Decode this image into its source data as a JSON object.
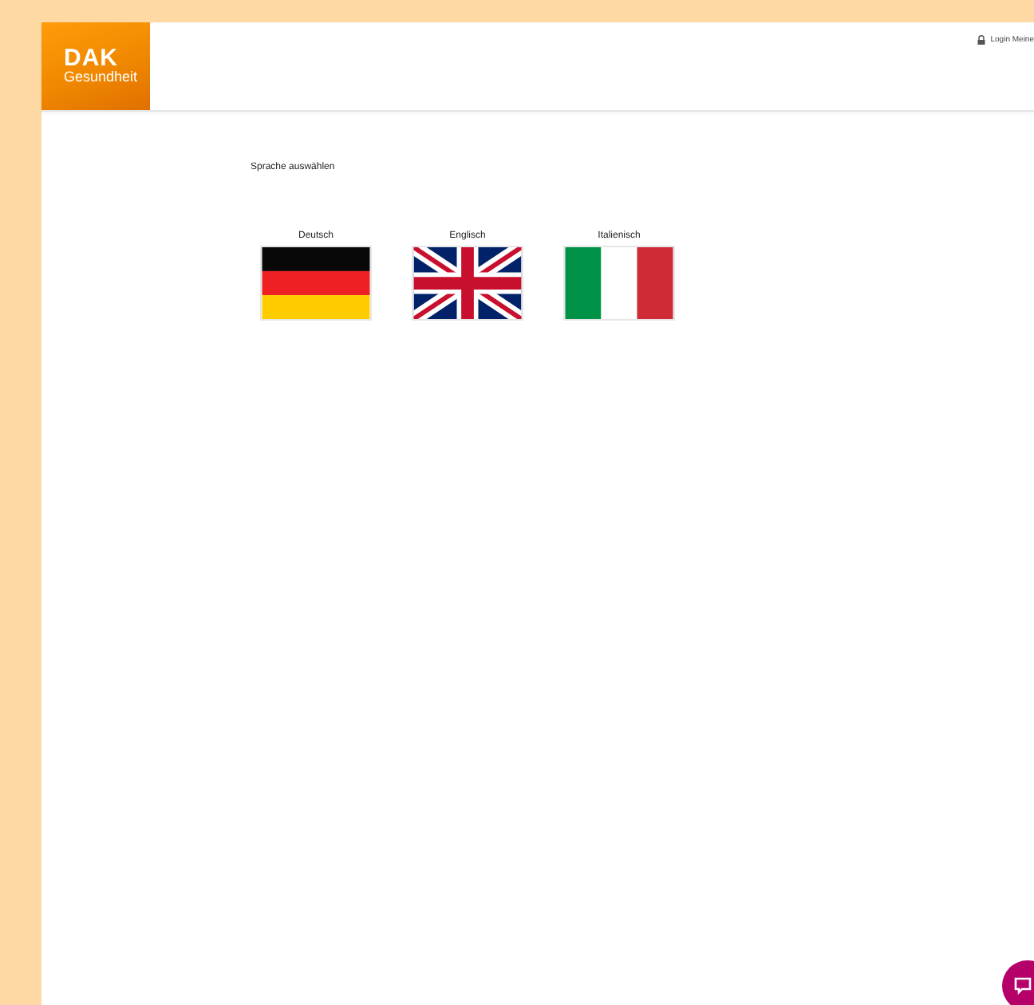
{
  "header": {
    "logo": {
      "brand": "DAK",
      "subtitle": "Gesundheit"
    },
    "login": "Login Meine"
  },
  "prompt": "Sprache auswählen",
  "languages": [
    {
      "label": "Deutsch",
      "kind": "german"
    },
    {
      "label": "Englisch",
      "kind": "british"
    },
    {
      "label": "Italienisch",
      "kind": "italian"
    }
  ]
}
